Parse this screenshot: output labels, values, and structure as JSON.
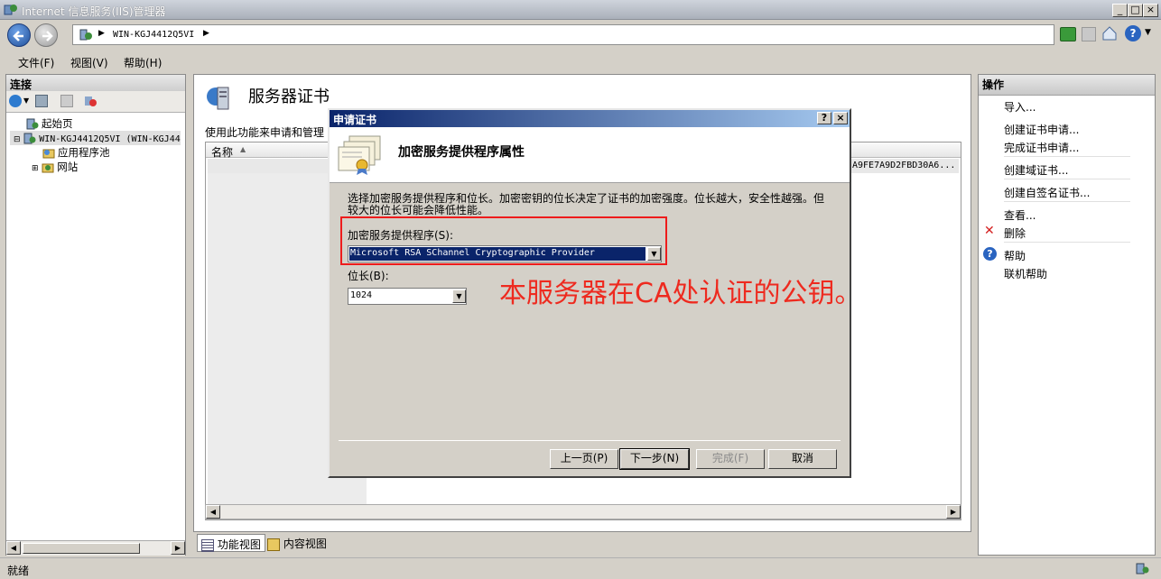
{
  "window": {
    "title": "Internet 信息服务(IIS)管理器",
    "min": "_",
    "max": "□",
    "close": "×"
  },
  "nav": {
    "address": "WIN-KGJ4412Q5VI",
    "help_btn": "?"
  },
  "menu": {
    "file": "文件(F)",
    "view": "视图(V)",
    "help": "帮助(H)"
  },
  "left": {
    "header": "连接",
    "tree": {
      "start": "起始页",
      "server": "WIN-KGJ4412Q5VI (WIN-KGJ44",
      "apppool": "应用程序池",
      "sites": "网站"
    }
  },
  "center": {
    "title": "服务器证书",
    "desc": "使用此功能来申请和管理",
    "col_name": "名称",
    "hash_fragment": "A9FE7A9D2FBD30A6..."
  },
  "view_tabs": {
    "features": "功能视图",
    "content": "内容视图"
  },
  "right": {
    "header": "操作",
    "import": "导入...",
    "create_req": "创建证书申请...",
    "complete_req": "完成证书申请...",
    "domain_cert": "创建域证书...",
    "self_signed": "创建自签名证书...",
    "view": "查看...",
    "delete": "删除",
    "help": "帮助",
    "online_help": "联机帮助"
  },
  "status": {
    "text": "就绪"
  },
  "dialog": {
    "title": "申请证书",
    "help": "?",
    "close": "×",
    "heading": "加密服务提供程序属性",
    "desc": "选择加密服务提供程序和位长。加密密钥的位长决定了证书的加密强度。位长越大，安全性越强。但较大的位长可能会降低性能。",
    "provider_label": "加密服务提供程序(S):",
    "provider_value": "Microsoft RSA SChannel Cryptographic Provider",
    "bitlen_label": "位长(B):",
    "bitlen_value": "1024",
    "btn_prev": "上一页(P)",
    "btn_next": "下一步(N)",
    "btn_finish": "完成(F)",
    "btn_cancel": "取消"
  },
  "annotation": {
    "text": "本服务器在CA处认证的公钥。",
    "color": "#ee2a1f"
  }
}
